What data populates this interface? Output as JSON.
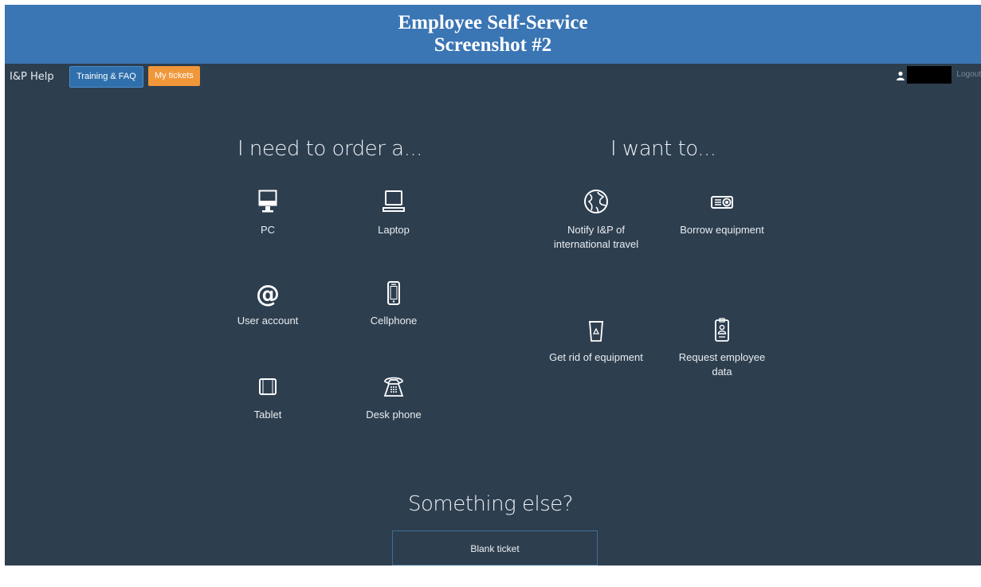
{
  "banner": {
    "line1": "Employee Self-Service",
    "line2": "Screenshot #2"
  },
  "topbar": {
    "brand": "I&P Help",
    "training_label": "Training & FAQ",
    "tickets_label": "My tickets",
    "logout_label": "Logout",
    "user_icon": "user-icon"
  },
  "order": {
    "title": "I need to order a...",
    "items": [
      {
        "label": "PC",
        "icon": "desktop-icon"
      },
      {
        "label": "Laptop",
        "icon": "laptop-icon"
      },
      {
        "label": "User account",
        "icon": "at-icon"
      },
      {
        "label": "Cellphone",
        "icon": "cellphone-icon"
      },
      {
        "label": "Tablet",
        "icon": "tablet-icon"
      },
      {
        "label": "Desk phone",
        "icon": "desk-phone-icon"
      }
    ]
  },
  "want": {
    "title": "I want to...",
    "items": [
      {
        "label": "Notify I&P of international travel",
        "icon": "globe-icon"
      },
      {
        "label": "Borrow equipment",
        "icon": "projector-icon"
      },
      {
        "label": "Get rid of equipment",
        "icon": "recycle-bin-icon"
      },
      {
        "label": "Request employee data",
        "icon": "id-badge-icon"
      }
    ]
  },
  "else": {
    "title": "Something else?",
    "blank_ticket_label": "Blank ticket"
  },
  "colors": {
    "banner": "#3a75b4",
    "background": "#2d3e4f",
    "training_button": "#2f6fab",
    "tickets_button": "#f0973a"
  }
}
